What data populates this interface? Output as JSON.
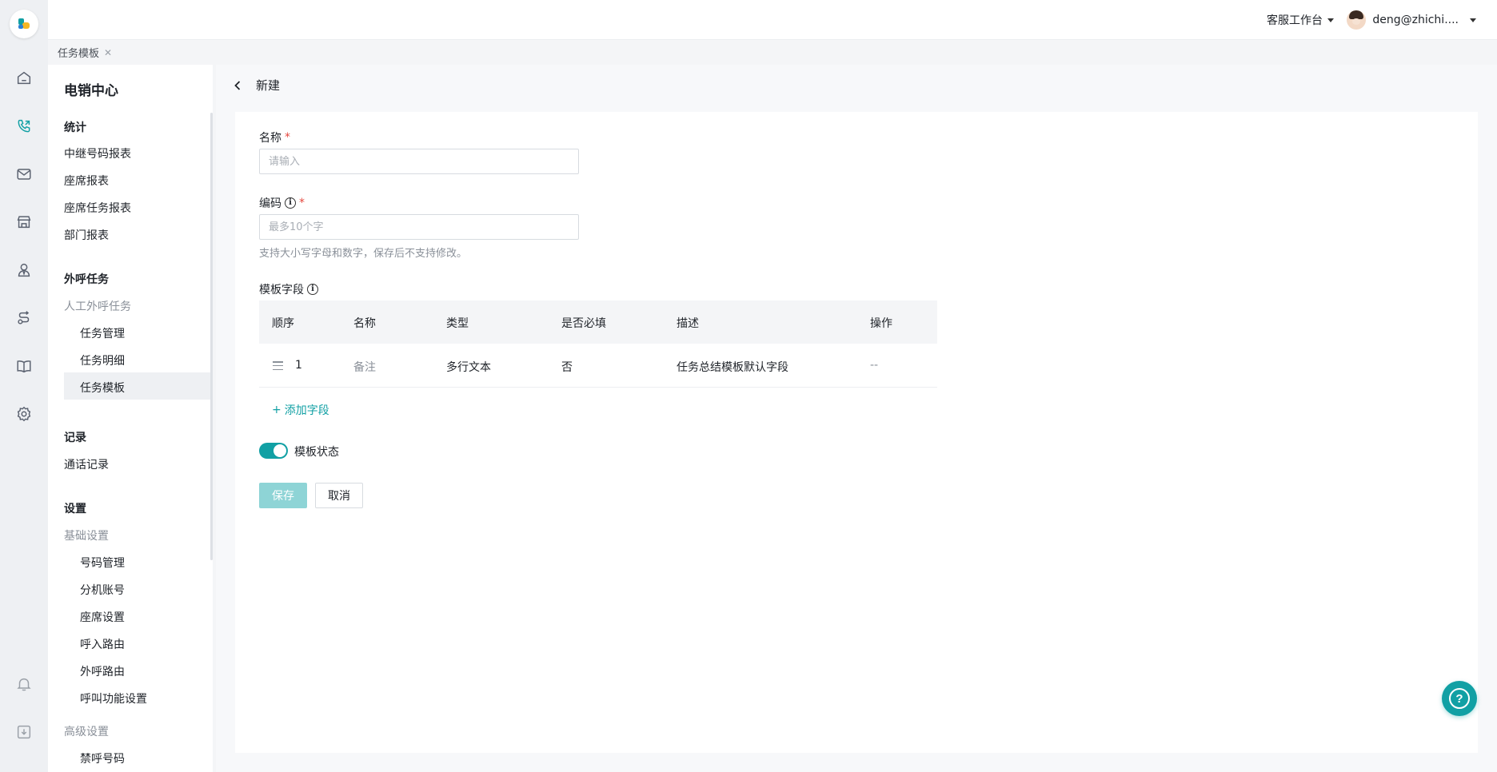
{
  "header": {
    "workspace_label": "客服工作台",
    "user_name": "deng@zhichi...."
  },
  "tabs": [
    {
      "label": "任务模板"
    }
  ],
  "sidebar": {
    "title": "电销中心",
    "groups": [
      {
        "title": "统计",
        "items": [
          "中继号码报表",
          "座席报表",
          "座席任务报表",
          "部门报表"
        ]
      },
      {
        "title": "外呼任务",
        "sub_title": "人工外呼任务",
        "items": [
          "任务管理",
          "任务明细",
          "任务模板"
        ]
      },
      {
        "title": "记录",
        "items": [
          "通话记录"
        ]
      },
      {
        "title": "设置",
        "sub_title": "基础设置",
        "items": [
          "号码管理",
          "分机账号",
          "座席设置",
          "呼入路由",
          "外呼路由",
          "呼叫功能设置"
        ],
        "sub_title_2": "高级设置",
        "items_2": [
          "禁呼号码"
        ]
      }
    ],
    "active_item": "任务模板"
  },
  "page": {
    "title": "新建",
    "name_label": "名称",
    "name_placeholder": "请输入",
    "code_label": "编码",
    "code_placeholder": "最多10个字",
    "code_hint": "支持大小写字母和数字，保存后不支持修改。",
    "fields_label": "模板字段",
    "table": {
      "columns": [
        "顺序",
        "名称",
        "类型",
        "是否必填",
        "描述",
        "操作"
      ],
      "rows": [
        {
          "order": "1",
          "name": "备注",
          "type": "多行文本",
          "required": "否",
          "description": "任务总结模板默认字段",
          "action": "--"
        }
      ]
    },
    "add_field_label": "添加字段",
    "status_label": "模板状态",
    "status_on": true,
    "save_label": "保存",
    "cancel_label": "取消"
  },
  "colors": {
    "accent": "#11a0a4",
    "required": "#e5483f"
  }
}
